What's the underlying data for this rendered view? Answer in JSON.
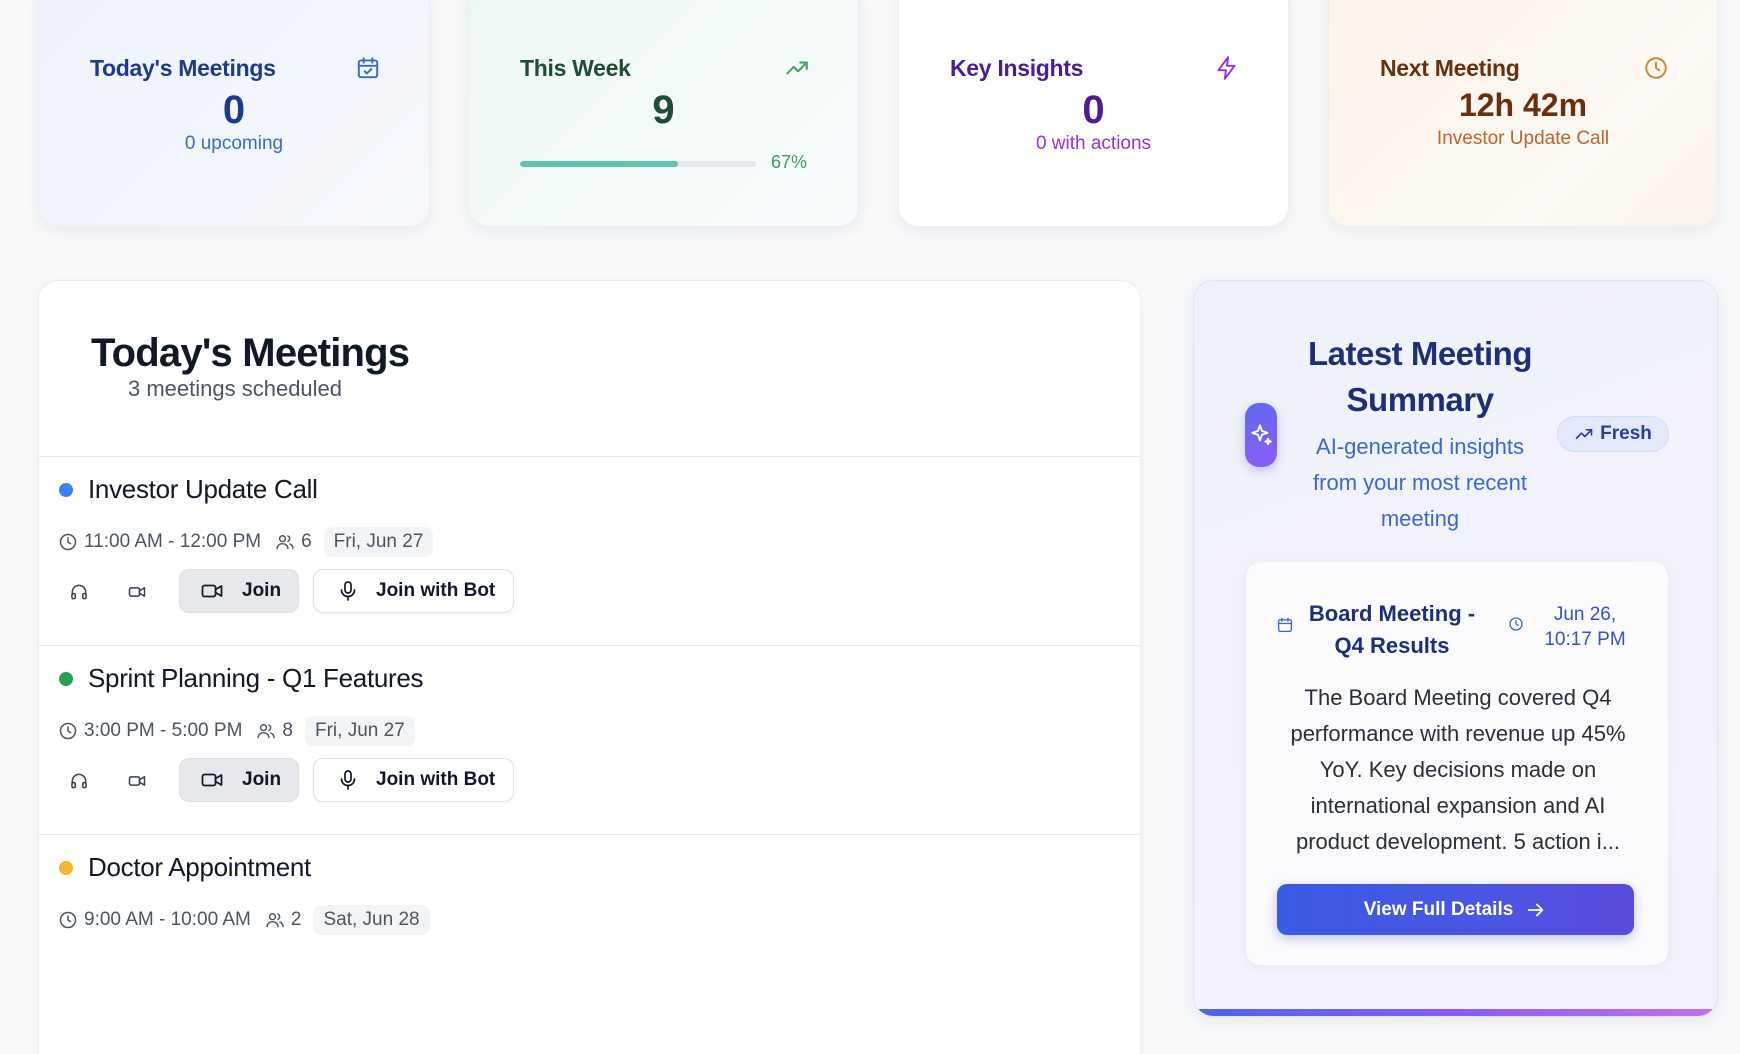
{
  "stats": {
    "today": {
      "title": "Today's Meetings",
      "value": "0",
      "sub": "0 upcoming",
      "icon": "calendar-check-icon",
      "color": "#1e3a8a",
      "sub_color": "#3b67d6"
    },
    "week": {
      "title": "This Week",
      "value": "9",
      "progress": 0.67,
      "progress_label": "67%",
      "icon": "trending-up-icon",
      "color": "#1f4d32",
      "accent": "#5fc4b2"
    },
    "insights": {
      "title": "Key Insights",
      "value": "0",
      "sub": "0 with actions",
      "icon": "zap-icon",
      "color": "#4c1d95",
      "sub_color": "#9333ea"
    },
    "next": {
      "title": "Next Meeting",
      "value": "12h 42m",
      "sub": "Investor Update Call",
      "icon": "clock-icon",
      "color": "#6b2f0f",
      "sub_color": "#c2622a"
    }
  },
  "meetings_panel": {
    "title": "Today's Meetings",
    "subtitle": "3 meetings scheduled",
    "join_label": "Join",
    "bot_label": "Join with Bot",
    "items": [
      {
        "title": "Investor Update Call",
        "time": "11:00 AM - 12:00 PM",
        "attendees": "6",
        "date": "Fri, Jun 27",
        "dot_color": "#3b82f6",
        "has_actions": true
      },
      {
        "title": "Sprint Planning - Q1 Features",
        "time": "3:00 PM - 5:00 PM",
        "attendees": "8",
        "date": "Fri, Jun 27",
        "dot_color": "#22a054",
        "has_actions": true
      },
      {
        "title": "Doctor Appointment",
        "time": "9:00 AM - 10:00 AM",
        "attendees": "2",
        "date": "Sat, Jun 28",
        "dot_color": "#f5b52e",
        "has_actions": false
      }
    ]
  },
  "summary": {
    "title": "Latest Meeting Summary",
    "description": "AI-generated insights from your most recent meeting",
    "badge": "Fresh",
    "meeting_title": "Board Meeting - Q4 Results",
    "meeting_date": "Jun 26, 10:17 PM",
    "text": "The Board Meeting covered Q4 performance with revenue up 45% YoY. Key decisions made on international expansion and AI product development. 5 action i...",
    "button": "View Full Details"
  }
}
